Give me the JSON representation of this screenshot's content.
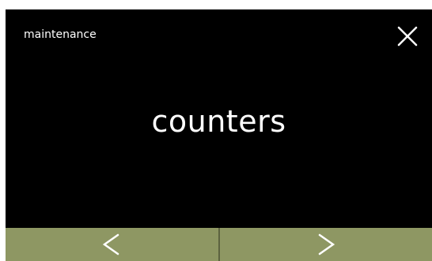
{
  "header": {
    "title": "maintenance",
    "close_icon": "close-icon"
  },
  "main": {
    "heading": "counters"
  },
  "nav": {
    "prev_icon": "chevron-left-icon",
    "next_icon": "chevron-right-icon"
  },
  "colors": {
    "background": "#000000",
    "text": "#ffffff",
    "nav_button": "#8e9763"
  }
}
